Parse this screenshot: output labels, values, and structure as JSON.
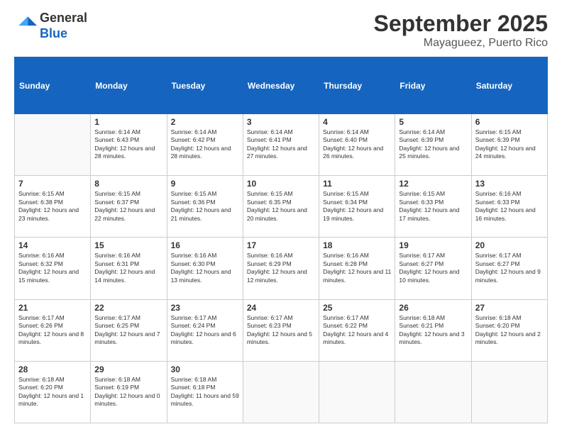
{
  "logo": {
    "line1": "General",
    "line2": "Blue"
  },
  "header": {
    "month": "September 2025",
    "location": "Mayagueez, Puerto Rico"
  },
  "weekdays": [
    "Sunday",
    "Monday",
    "Tuesday",
    "Wednesday",
    "Thursday",
    "Friday",
    "Saturday"
  ],
  "weeks": [
    [
      {
        "date": "",
        "sunrise": "",
        "sunset": "",
        "daylight": ""
      },
      {
        "date": "1",
        "sunrise": "Sunrise: 6:14 AM",
        "sunset": "Sunset: 6:43 PM",
        "daylight": "Daylight: 12 hours and 28 minutes."
      },
      {
        "date": "2",
        "sunrise": "Sunrise: 6:14 AM",
        "sunset": "Sunset: 6:42 PM",
        "daylight": "Daylight: 12 hours and 28 minutes."
      },
      {
        "date": "3",
        "sunrise": "Sunrise: 6:14 AM",
        "sunset": "Sunset: 6:41 PM",
        "daylight": "Daylight: 12 hours and 27 minutes."
      },
      {
        "date": "4",
        "sunrise": "Sunrise: 6:14 AM",
        "sunset": "Sunset: 6:40 PM",
        "daylight": "Daylight: 12 hours and 26 minutes."
      },
      {
        "date": "5",
        "sunrise": "Sunrise: 6:14 AM",
        "sunset": "Sunset: 6:39 PM",
        "daylight": "Daylight: 12 hours and 25 minutes."
      },
      {
        "date": "6",
        "sunrise": "Sunrise: 6:15 AM",
        "sunset": "Sunset: 6:39 PM",
        "daylight": "Daylight: 12 hours and 24 minutes."
      }
    ],
    [
      {
        "date": "7",
        "sunrise": "Sunrise: 6:15 AM",
        "sunset": "Sunset: 6:38 PM",
        "daylight": "Daylight: 12 hours and 23 minutes."
      },
      {
        "date": "8",
        "sunrise": "Sunrise: 6:15 AM",
        "sunset": "Sunset: 6:37 PM",
        "daylight": "Daylight: 12 hours and 22 minutes."
      },
      {
        "date": "9",
        "sunrise": "Sunrise: 6:15 AM",
        "sunset": "Sunset: 6:36 PM",
        "daylight": "Daylight: 12 hours and 21 minutes."
      },
      {
        "date": "10",
        "sunrise": "Sunrise: 6:15 AM",
        "sunset": "Sunset: 6:35 PM",
        "daylight": "Daylight: 12 hours and 20 minutes."
      },
      {
        "date": "11",
        "sunrise": "Sunrise: 6:15 AM",
        "sunset": "Sunset: 6:34 PM",
        "daylight": "Daylight: 12 hours and 19 minutes."
      },
      {
        "date": "12",
        "sunrise": "Sunrise: 6:15 AM",
        "sunset": "Sunset: 6:33 PM",
        "daylight": "Daylight: 12 hours and 17 minutes."
      },
      {
        "date": "13",
        "sunrise": "Sunrise: 6:16 AM",
        "sunset": "Sunset: 6:33 PM",
        "daylight": "Daylight: 12 hours and 16 minutes."
      }
    ],
    [
      {
        "date": "14",
        "sunrise": "Sunrise: 6:16 AM",
        "sunset": "Sunset: 6:32 PM",
        "daylight": "Daylight: 12 hours and 15 minutes."
      },
      {
        "date": "15",
        "sunrise": "Sunrise: 6:16 AM",
        "sunset": "Sunset: 6:31 PM",
        "daylight": "Daylight: 12 hours and 14 minutes."
      },
      {
        "date": "16",
        "sunrise": "Sunrise: 6:16 AM",
        "sunset": "Sunset: 6:30 PM",
        "daylight": "Daylight: 12 hours and 13 minutes."
      },
      {
        "date": "17",
        "sunrise": "Sunrise: 6:16 AM",
        "sunset": "Sunset: 6:29 PM",
        "daylight": "Daylight: 12 hours and 12 minutes."
      },
      {
        "date": "18",
        "sunrise": "Sunrise: 6:16 AM",
        "sunset": "Sunset: 6:28 PM",
        "daylight": "Daylight: 12 hours and 11 minutes."
      },
      {
        "date": "19",
        "sunrise": "Sunrise: 6:17 AM",
        "sunset": "Sunset: 6:27 PM",
        "daylight": "Daylight: 12 hours and 10 minutes."
      },
      {
        "date": "20",
        "sunrise": "Sunrise: 6:17 AM",
        "sunset": "Sunset: 6:27 PM",
        "daylight": "Daylight: 12 hours and 9 minutes."
      }
    ],
    [
      {
        "date": "21",
        "sunrise": "Sunrise: 6:17 AM",
        "sunset": "Sunset: 6:26 PM",
        "daylight": "Daylight: 12 hours and 8 minutes."
      },
      {
        "date": "22",
        "sunrise": "Sunrise: 6:17 AM",
        "sunset": "Sunset: 6:25 PM",
        "daylight": "Daylight: 12 hours and 7 minutes."
      },
      {
        "date": "23",
        "sunrise": "Sunrise: 6:17 AM",
        "sunset": "Sunset: 6:24 PM",
        "daylight": "Daylight: 12 hours and 6 minutes."
      },
      {
        "date": "24",
        "sunrise": "Sunrise: 6:17 AM",
        "sunset": "Sunset: 6:23 PM",
        "daylight": "Daylight: 12 hours and 5 minutes."
      },
      {
        "date": "25",
        "sunrise": "Sunrise: 6:17 AM",
        "sunset": "Sunset: 6:22 PM",
        "daylight": "Daylight: 12 hours and 4 minutes."
      },
      {
        "date": "26",
        "sunrise": "Sunrise: 6:18 AM",
        "sunset": "Sunset: 6:21 PM",
        "daylight": "Daylight: 12 hours and 3 minutes."
      },
      {
        "date": "27",
        "sunrise": "Sunrise: 6:18 AM",
        "sunset": "Sunset: 6:20 PM",
        "daylight": "Daylight: 12 hours and 2 minutes."
      }
    ],
    [
      {
        "date": "28",
        "sunrise": "Sunrise: 6:18 AM",
        "sunset": "Sunset: 6:20 PM",
        "daylight": "Daylight: 12 hours and 1 minute."
      },
      {
        "date": "29",
        "sunrise": "Sunrise: 6:18 AM",
        "sunset": "Sunset: 6:19 PM",
        "daylight": "Daylight: 12 hours and 0 minutes."
      },
      {
        "date": "30",
        "sunrise": "Sunrise: 6:18 AM",
        "sunset": "Sunset: 6:18 PM",
        "daylight": "Daylight: 11 hours and 59 minutes."
      },
      {
        "date": "",
        "sunrise": "",
        "sunset": "",
        "daylight": ""
      },
      {
        "date": "",
        "sunrise": "",
        "sunset": "",
        "daylight": ""
      },
      {
        "date": "",
        "sunrise": "",
        "sunset": "",
        "daylight": ""
      },
      {
        "date": "",
        "sunrise": "",
        "sunset": "",
        "daylight": ""
      }
    ]
  ]
}
